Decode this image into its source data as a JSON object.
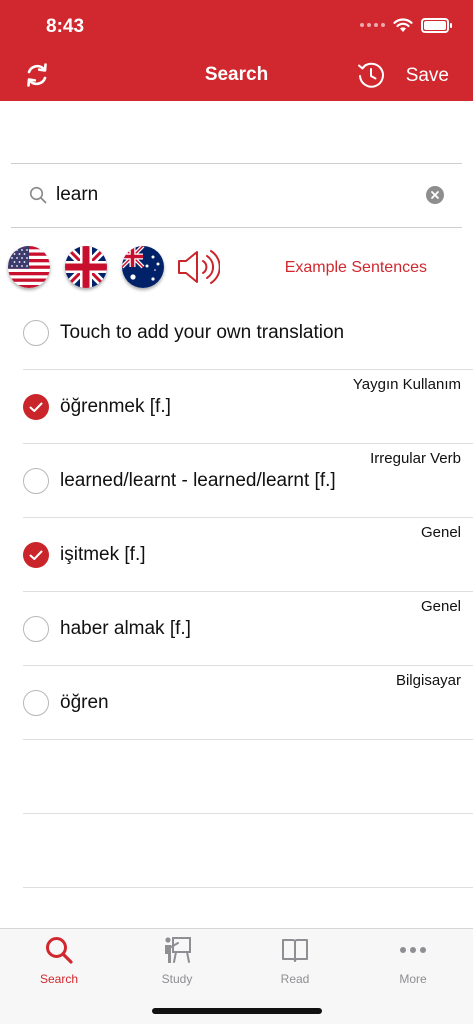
{
  "status": {
    "time": "8:43"
  },
  "header": {
    "title": "Search",
    "save_label": "Save"
  },
  "search": {
    "value": "learn",
    "placeholder": ""
  },
  "example_sentences_label": "Example Sentences",
  "translations": [
    {
      "text": "Touch to add your own translation",
      "tag": "",
      "checked": false
    },
    {
      "text": "öğrenmek [f.]",
      "tag": "Yaygın Kullanım",
      "checked": true
    },
    {
      "text": "learned/learnt - learned/learnt [f.]",
      "tag": "Irregular Verb",
      "checked": false
    },
    {
      "text": "işitmek [f.]",
      "tag": "Genel",
      "checked": true
    },
    {
      "text": "haber almak [f.]",
      "tag": "Genel",
      "checked": false
    },
    {
      "text": "öğren",
      "tag": "Bilgisayar",
      "checked": false
    }
  ],
  "tabs": [
    {
      "label": "Search",
      "icon": "search-icon",
      "active": true
    },
    {
      "label": "Study",
      "icon": "study-icon",
      "active": false
    },
    {
      "label": "Read",
      "icon": "book-icon",
      "active": false
    },
    {
      "label": "More",
      "icon": "more-icon",
      "active": false
    }
  ],
  "colors": {
    "accent": "#d0282e",
    "check": "#c9252b"
  }
}
